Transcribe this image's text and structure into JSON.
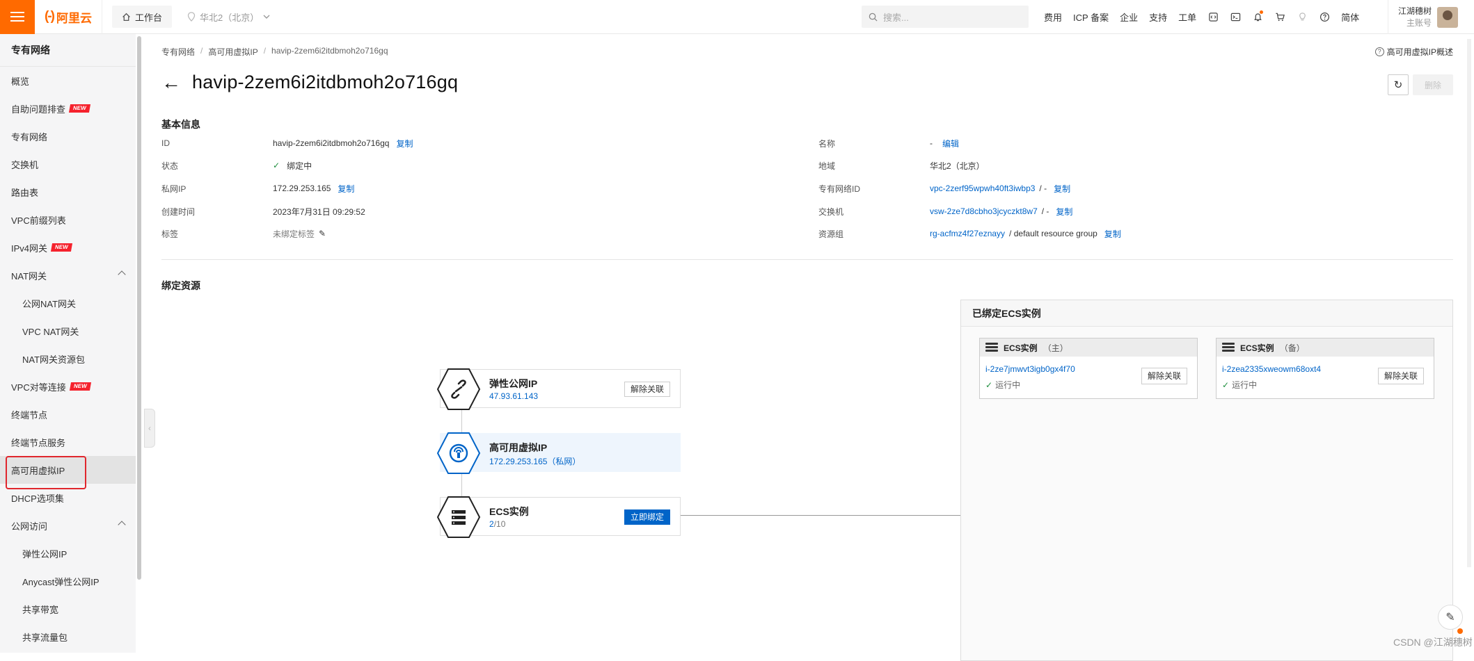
{
  "topbar": {
    "logo": "阿里云",
    "logo_mark": "(-)",
    "workbench": "工作台",
    "region": "华北2（北京）",
    "search_placeholder": "搜索...",
    "nav": [
      "费用",
      "ICP 备案",
      "企业",
      "支持",
      "工单"
    ],
    "lang": "简体",
    "user_name": "江湖穗树",
    "user_role": "主账号"
  },
  "sidebar": {
    "title": "专有网络",
    "items": [
      {
        "label": "概览",
        "level": 1
      },
      {
        "label": "自助问题排查",
        "level": 1,
        "badge": "NEW"
      },
      {
        "label": "专有网络",
        "level": 1
      },
      {
        "label": "交换机",
        "level": 1
      },
      {
        "label": "路由表",
        "level": 1
      },
      {
        "label": "VPC前缀列表",
        "level": 1
      },
      {
        "label": "IPv4网关",
        "level": 1,
        "badge": "NEW"
      },
      {
        "label": "NAT网关",
        "level": 1,
        "expanded": true
      },
      {
        "label": "公网NAT网关",
        "level": 2
      },
      {
        "label": "VPC NAT网关",
        "level": 2
      },
      {
        "label": "NAT网关资源包",
        "level": 2
      },
      {
        "label": "VPC对等连接",
        "level": 1,
        "badge": "NEW"
      },
      {
        "label": "终端节点",
        "level": 1
      },
      {
        "label": "终端节点服务",
        "level": 1
      },
      {
        "label": "高可用虚拟IP",
        "level": 1,
        "active": true
      },
      {
        "label": "DHCP选项集",
        "level": 1
      },
      {
        "label": "公网访问",
        "level": 1,
        "expanded": true,
        "bold": true
      },
      {
        "label": "弹性公网IP",
        "level": 2
      },
      {
        "label": "Anycast弹性公网IP",
        "level": 2
      },
      {
        "label": "共享带宽",
        "level": 2
      },
      {
        "label": "共享流量包",
        "level": 2
      }
    ]
  },
  "breadcrumb": [
    "专有网络",
    "高可用虚拟IP",
    "havip-2zem6i2itdbmoh2o716gq"
  ],
  "help_link": "高可用虚拟IP概述",
  "page": {
    "title": "havip-2zem6i2itdbmoh2o716gq",
    "delete_label": "删除"
  },
  "basic_info": {
    "section_title": "基本信息",
    "copy_label": "复制",
    "left": {
      "id_label": "ID",
      "id_value": "havip-2zem6i2itdbmoh2o716gq",
      "status_label": "状态",
      "status_value": "绑定中",
      "private_ip_label": "私网IP",
      "private_ip_value": "172.29.253.165",
      "created_label": "创建时间",
      "created_value": "2023年7月31日 09:29:52",
      "tag_label": "标签",
      "tag_value": "未绑定标签"
    },
    "right": {
      "name_label": "名称",
      "name_value": "-",
      "edit_label": "编辑",
      "region_label": "地域",
      "region_value": "华北2（北京）",
      "vpc_label": "专有网络ID",
      "vpc_value": "vpc-2zerf95wpwh40ft3iwbp3",
      "vpc_suffix": "/ -",
      "vsw_label": "交换机",
      "vsw_value": "vsw-2ze7d8cbho3jcyczkt8w7",
      "vsw_suffix": "/ -",
      "rg_label": "资源组",
      "rg_value": "rg-acfmz4f27eznayy",
      "rg_suffix": "/ default resource group"
    }
  },
  "bound": {
    "section_title": "绑定资源",
    "nodes": {
      "eip": {
        "title": "弹性公网IP",
        "value": "47.93.61.143",
        "button": "解除关联"
      },
      "havip": {
        "title": "高可用虚拟IP",
        "value": "172.29.253.165（私网）"
      },
      "ecs": {
        "title": "ECS实例",
        "count": "2",
        "limit": "/10",
        "button": "立即绑定"
      }
    }
  },
  "ecs_panel": {
    "title": "已绑定ECS实例",
    "cards": [
      {
        "title": "ECS实例",
        "role": "（主）",
        "id": "i-2ze7jmwvt3igb0gx4f70",
        "status": "运行中",
        "button": "解除关联"
      },
      {
        "title": "ECS实例",
        "role": "（备）",
        "id": "i-2zea2335xweowm68oxt4",
        "status": "运行中",
        "button": "解除关联"
      }
    ]
  },
  "watermark": "CSDN @江湖穗树",
  "colors": {
    "brand": "#ff6a00",
    "link": "#0064c8",
    "success": "#1e8e3e",
    "badge": "#f5222d",
    "highlight": "#e0262d"
  }
}
